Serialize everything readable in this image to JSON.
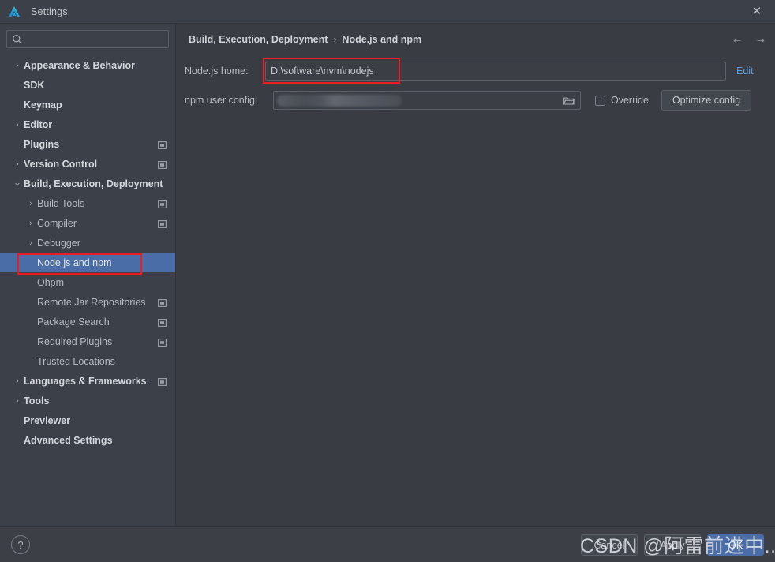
{
  "window": {
    "title": "Settings",
    "logo_icon": "deveco-logo-icon",
    "close_icon": "✕"
  },
  "sidebar": {
    "search": {
      "value": "",
      "placeholder": "",
      "icon": "search-icon",
      "dropdown_icon": "chevron-down-icon"
    },
    "items": [
      {
        "label": "Appearance & Behavior",
        "level": 0,
        "bold": true,
        "chevron": "collapsed",
        "badge": false,
        "selected": false
      },
      {
        "label": "SDK",
        "level": 0,
        "bold": true,
        "chevron": "none",
        "badge": false,
        "selected": false
      },
      {
        "label": "Keymap",
        "level": 0,
        "bold": true,
        "chevron": "none",
        "badge": false,
        "selected": false
      },
      {
        "label": "Editor",
        "level": 0,
        "bold": true,
        "chevron": "collapsed",
        "badge": false,
        "selected": false
      },
      {
        "label": "Plugins",
        "level": 0,
        "bold": true,
        "chevron": "none",
        "badge": true,
        "selected": false
      },
      {
        "label": "Version Control",
        "level": 0,
        "bold": true,
        "chevron": "collapsed",
        "badge": true,
        "selected": false
      },
      {
        "label": "Build, Execution, Deployment",
        "level": 0,
        "bold": true,
        "chevron": "expanded",
        "badge": false,
        "selected": false
      },
      {
        "label": "Build Tools",
        "level": 1,
        "bold": false,
        "chevron": "collapsed",
        "badge": true,
        "selected": false
      },
      {
        "label": "Compiler",
        "level": 1,
        "bold": false,
        "chevron": "collapsed",
        "badge": true,
        "selected": false
      },
      {
        "label": "Debugger",
        "level": 1,
        "bold": false,
        "chevron": "collapsed",
        "badge": false,
        "selected": false
      },
      {
        "label": "Node.js and npm",
        "level": 1,
        "bold": false,
        "chevron": "none",
        "badge": false,
        "selected": true
      },
      {
        "label": "Ohpm",
        "level": 1,
        "bold": false,
        "chevron": "none",
        "badge": false,
        "selected": false
      },
      {
        "label": "Remote Jar Repositories",
        "level": 1,
        "bold": false,
        "chevron": "none",
        "badge": true,
        "selected": false
      },
      {
        "label": "Package Search",
        "level": 1,
        "bold": false,
        "chevron": "none",
        "badge": true,
        "selected": false
      },
      {
        "label": "Required Plugins",
        "level": 1,
        "bold": false,
        "chevron": "none",
        "badge": true,
        "selected": false
      },
      {
        "label": "Trusted Locations",
        "level": 1,
        "bold": false,
        "chevron": "none",
        "badge": false,
        "selected": false
      },
      {
        "label": "Languages & Frameworks",
        "level": 0,
        "bold": true,
        "chevron": "collapsed",
        "badge": true,
        "selected": false
      },
      {
        "label": "Tools",
        "level": 0,
        "bold": true,
        "chevron": "collapsed",
        "badge": false,
        "selected": false
      },
      {
        "label": "Previewer",
        "level": 0,
        "bold": true,
        "chevron": "none",
        "badge": false,
        "selected": false
      },
      {
        "label": "Advanced Settings",
        "level": 0,
        "bold": true,
        "chevron": "none",
        "badge": false,
        "selected": false
      }
    ]
  },
  "content": {
    "breadcrumb": {
      "parent": "Build, Execution, Deployment",
      "separator": "›",
      "current": "Node.js and npm"
    },
    "nav": {
      "back_icon": "←",
      "forward_icon": "→"
    },
    "node_home": {
      "label": "Node.js home:",
      "value": "D:\\software\\nvm\\nodejs",
      "edit_link": "Edit"
    },
    "npm_config": {
      "label": "npm user config:",
      "value": "",
      "browse_icon": "folder-icon",
      "override_label": "Override",
      "override_checked": false,
      "optimize_label": "Optimize config"
    }
  },
  "footer": {
    "help_label": "?",
    "cancel_label": "Cancel",
    "apply_label": "Apply",
    "ok_label": "OK"
  },
  "overlay": {
    "watermark": "CSDN @阿雷前进中...",
    "annotation_color": "#ec1c24"
  }
}
